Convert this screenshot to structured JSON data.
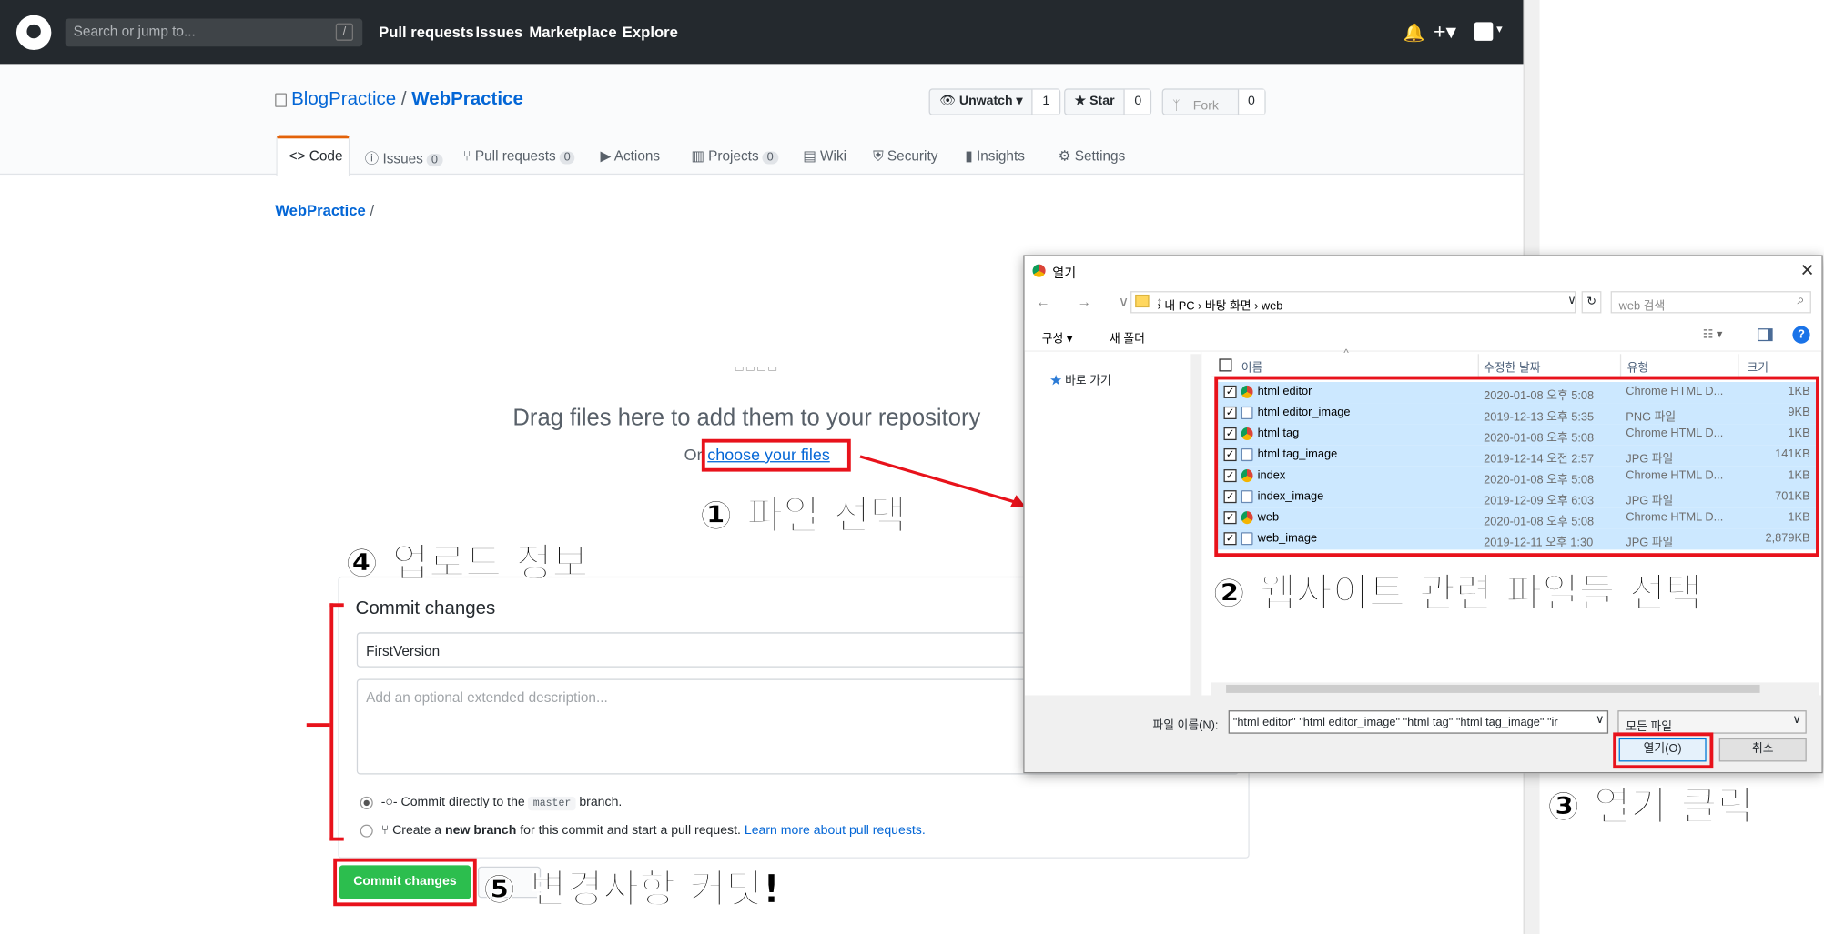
{
  "header": {
    "search_placeholder": "Search or jump to...",
    "slash": "/",
    "nav": [
      "Pull requests",
      "Issues",
      "Marketplace",
      "Explore"
    ]
  },
  "repo": {
    "owner": "BlogPractice",
    "sep": " / ",
    "name": "WebPractice",
    "unwatch": "Unwatch ▾",
    "watch_count": "1",
    "star": "★ Star",
    "star_count": "0",
    "fork": "Fork",
    "fork_count": "0"
  },
  "tabs": [
    {
      "label": "Code"
    },
    {
      "label": "Issues",
      "count": "0"
    },
    {
      "label": "Pull requests",
      "count": "0"
    },
    {
      "label": "Actions"
    },
    {
      "label": "Projects",
      "count": "0"
    },
    {
      "label": "Wiki"
    },
    {
      "label": "Security"
    },
    {
      "label": "Insights"
    },
    {
      "label": "Settings"
    }
  ],
  "breadcrumb": {
    "repo": "WebPractice",
    "sep": " /"
  },
  "upload": {
    "drag_text": "Drag files here to add them to your repository",
    "or": "Or",
    "choose": "choose your files"
  },
  "commit": {
    "heading": "Commit changes",
    "summary_value": "FirstVersion",
    "description_placeholder": "Add an optional extended description...",
    "opt1_a": "Commit directly to the",
    "opt1_branch": "master",
    "opt1_b": "branch.",
    "opt2_a": "Create a",
    "opt2_bold": "new branch",
    "opt2_b": "for this commit and start a pull request.",
    "opt2_link": "Learn more about pull requests.",
    "button": "Commit changes"
  },
  "annotations": {
    "a1": "① 파일 선택",
    "a2": "② 웹사이트 관련 파일들 선택",
    "a3": "③ 열기 클릭",
    "a4": "④ 업로드 정보",
    "a5": "⑤ 변경사항 커밋!"
  },
  "dialog": {
    "title": "열기",
    "close": "✕",
    "nav": "← → ∨ ↑",
    "path": "› 내 PC › 바탕 화면 › web",
    "search_placeholder": "web 검색",
    "organize": "구성 ▾",
    "new_folder": "새 폴더",
    "quick_access": "바로 가기",
    "columns": [
      "이름",
      "수정한 날짜",
      "유형",
      "크기"
    ],
    "files": [
      {
        "name": "html editor",
        "date": "2020-01-08 오후 5:08",
        "type": "Chrome HTML D...",
        "size": "1KB",
        "icon": "chrome"
      },
      {
        "name": "html editor_image",
        "date": "2019-12-13 오후 5:35",
        "type": "PNG 파일",
        "size": "9KB",
        "icon": "img"
      },
      {
        "name": "html tag",
        "date": "2020-01-08 오후 5:08",
        "type": "Chrome HTML D...",
        "size": "1KB",
        "icon": "chrome"
      },
      {
        "name": "html tag_image",
        "date": "2019-12-14 오전 2:57",
        "type": "JPG 파일",
        "size": "141KB",
        "icon": "img"
      },
      {
        "name": "index",
        "date": "2020-01-08 오후 5:08",
        "type": "Chrome HTML D...",
        "size": "1KB",
        "icon": "chrome"
      },
      {
        "name": "index_image",
        "date": "2019-12-09 오후 6:03",
        "type": "JPG 파일",
        "size": "701KB",
        "icon": "img"
      },
      {
        "name": "web",
        "date": "2020-01-08 오후 5:08",
        "type": "Chrome HTML D...",
        "size": "1KB",
        "icon": "chrome"
      },
      {
        "name": "web_image",
        "date": "2019-12-11 오후 1:30",
        "type": "JPG 파일",
        "size": "2,879KB",
        "icon": "img"
      }
    ],
    "filename_label": "파일 이름(N):",
    "filename_value": "\"html editor\" \"html editor_image\" \"html tag\" \"html tag_image\" \"ir",
    "filter": "모든 파일",
    "open": "열기(O)",
    "cancel": "취소"
  },
  "colors": {
    "header": "#24292e",
    "accent": "#0366d6",
    "commit": "#2cbe4e",
    "annotation_box": "#e8121b",
    "selection": "#cce8ff"
  }
}
